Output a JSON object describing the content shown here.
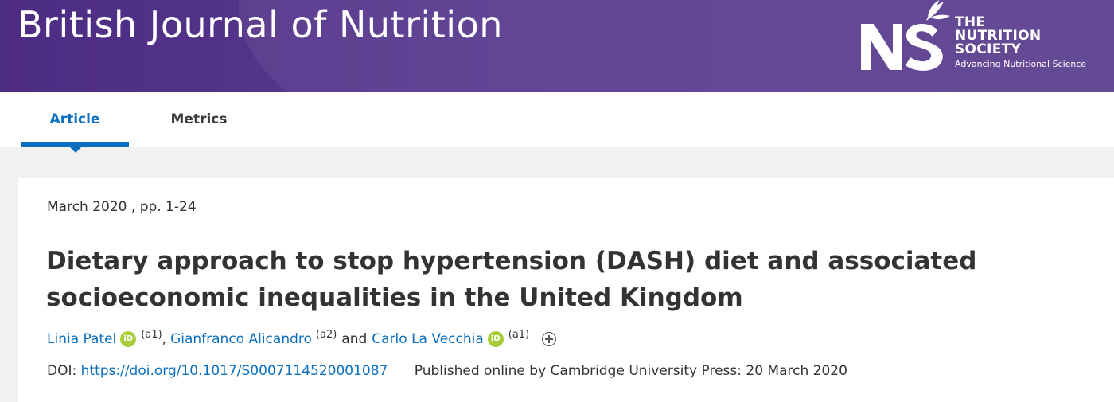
{
  "header": {
    "journal_title": "British Journal of Nutrition",
    "society": {
      "logo_text": "NS",
      "line1": "THE",
      "line2": "NUTRITION",
      "line3": "SOCIETY",
      "tagline": "Advancing Nutritional Science"
    },
    "brand_color": "#4d2c84"
  },
  "tabs": [
    {
      "label": "Article",
      "active": true
    },
    {
      "label": "Metrics",
      "active": false
    }
  ],
  "article": {
    "issue_meta": "March 2020 , pp. 1-24",
    "title": "Dietary approach to stop hypertension (DASH) diet and associated socioeconomic inequalities in the United Kingdom",
    "authors": [
      {
        "name": "Linia Patel",
        "orcid": true,
        "affiliation": "(a1)"
      },
      {
        "name": "Gianfranco Alicandro",
        "orcid": false,
        "affiliation": "(a2)"
      },
      {
        "name": "Carlo La Vecchia",
        "orcid": true,
        "affiliation": "(a1)"
      }
    ],
    "author_separator": ",",
    "author_conjunction": "and",
    "orcid_icon": "orcid-icon",
    "orcid_label": "iD",
    "expand_icon": "plus-circle-icon",
    "doi_label": "DOI:",
    "doi_url": "https://doi.org/10.1017/S0007114520001087",
    "published": "Published online by Cambridge University Press: 20 March 2020"
  },
  "colors": {
    "link": "#0b6fbf",
    "orcid": "#a6ce39"
  }
}
